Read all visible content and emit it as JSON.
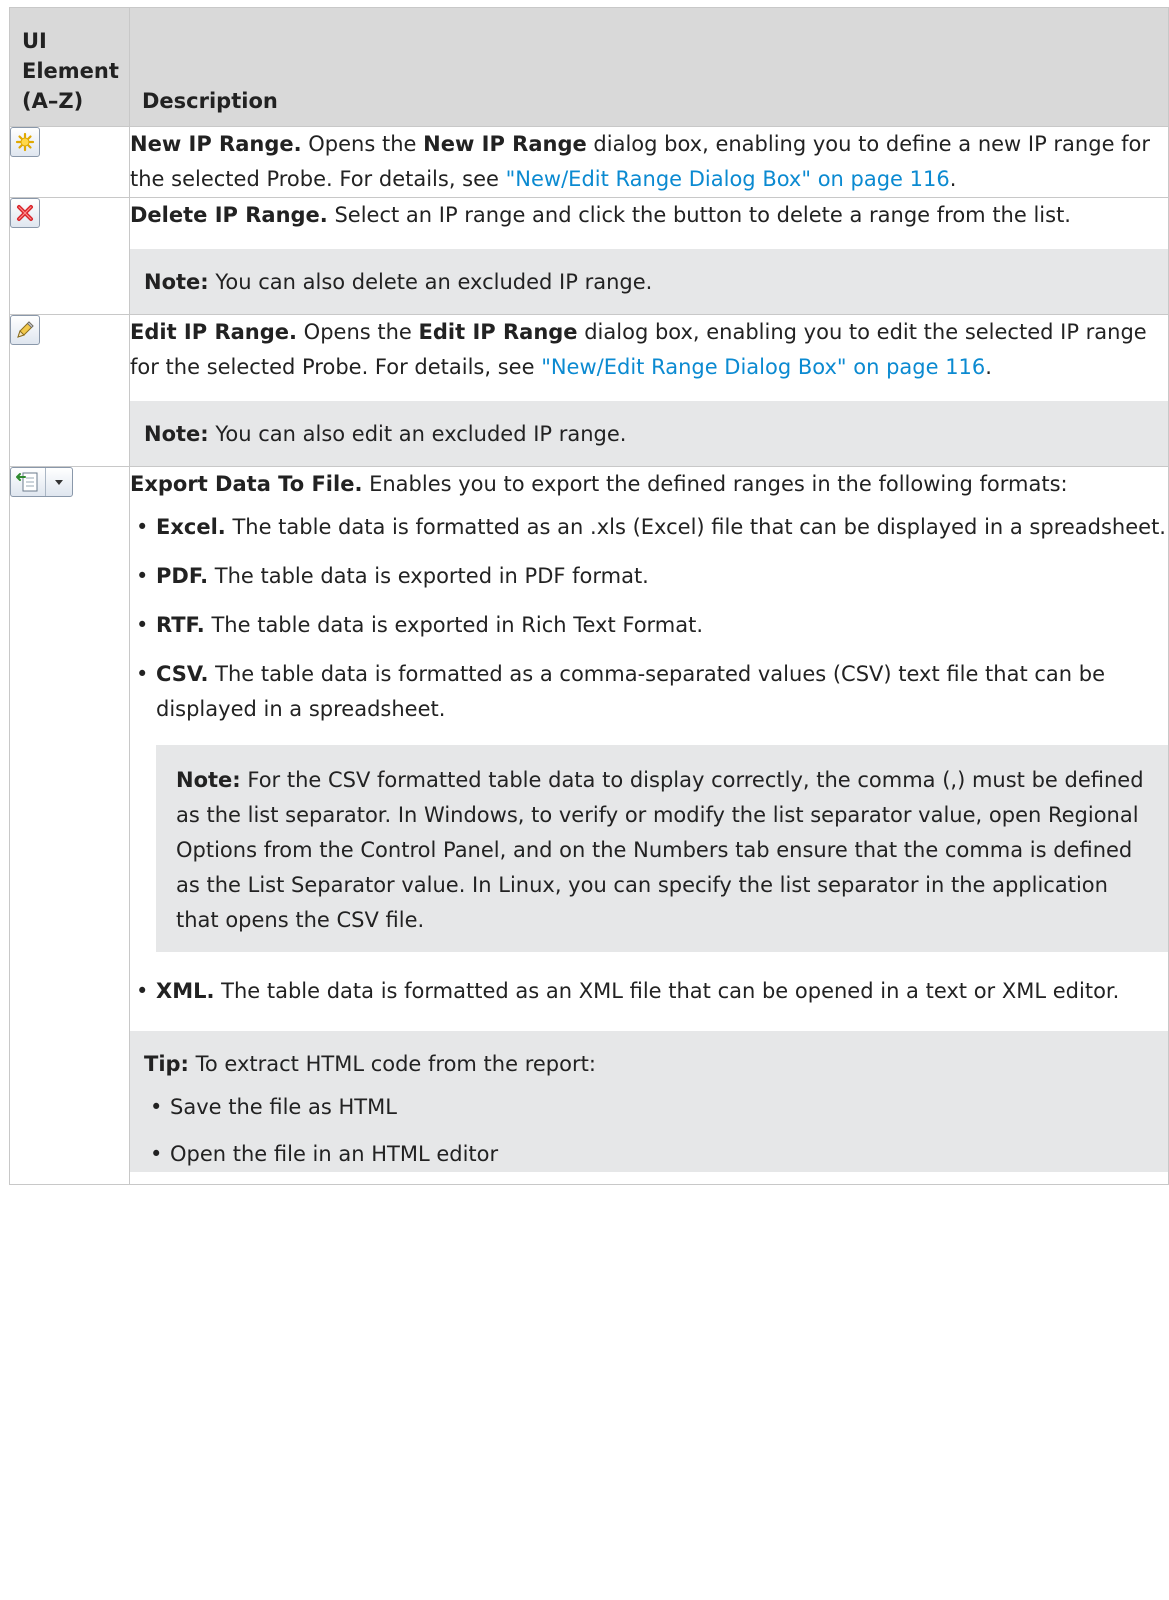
{
  "header": {
    "col1_line1": "UI",
    "col1_line2": "Element",
    "col1_line3": "(A–Z)",
    "col2": "Description"
  },
  "rows": [
    {
      "icon": "new-star-icon",
      "title": "New IP Range.",
      "text1": " Opens the ",
      "bold2": "New IP Range",
      "text2": " dialog box, enabling you to define a new IP range for the selected Probe. For details, see ",
      "link": "\"New/Edit Range Dialog Box\" on page 116",
      "text3": "."
    },
    {
      "icon": "delete-x-icon",
      "title": "Delete IP Range.",
      "text1": " Select an IP range and click the button to delete a range from the list.",
      "note_label": "Note:",
      "note_text": " You can also delete an excluded IP range."
    },
    {
      "icon": "pencil-edit-icon",
      "title": "Edit IP Range.",
      "text1": " Opens the ",
      "bold2": "Edit IP Range",
      "text2": " dialog box, enabling you to edit the selected IP range for the selected Probe. For details, see ",
      "link": "\"New/Edit Range Dialog Box\" on page 116",
      "text3": ".",
      "note_label": "Note:",
      "note_text": " You can also edit an excluded IP range."
    },
    {
      "icon": "export-file-icon",
      "title": "Export Data To File.",
      "text1": " Enables you to export the defined ranges in the following formats:",
      "formats": [
        {
          "label": "Excel.",
          "text": " The table data is formatted as an .xls (Excel) file that can be displayed in a spreadsheet."
        },
        {
          "label": "PDF.",
          "text": " The table data is exported in PDF format."
        },
        {
          "label": "RTF.",
          "text": " The table data is exported in Rich Text Format."
        },
        {
          "label": "CSV.",
          "text": " The table data is formatted as a comma-separated values (CSV) text file that can be displayed in a spreadsheet."
        }
      ],
      "csv_note_label": "Note:",
      "csv_note_text": " For the CSV formatted table data to display correctly, the comma (,) must be defined as the list separator. In Windows, to verify or modify the list separator value, open Regional Options from the Control Panel, and on the Numbers tab ensure that the comma is defined as the List Separator value. In Linux, you can specify the list separator in the application that opens the CSV file.",
      "xml_label": "XML.",
      "xml_text": " The table data is formatted as an XML file that can be opened in a text or XML editor.",
      "tip_label": "Tip:",
      "tip_text": " To extract HTML code from the report:",
      "tip_steps": [
        "Save the file as HTML",
        "Open the file in an HTML editor"
      ]
    }
  ],
  "colors": {
    "link": "#0b8ad1",
    "header_bg": "#d9d9d9",
    "note_bg": "#e6e7e8"
  }
}
